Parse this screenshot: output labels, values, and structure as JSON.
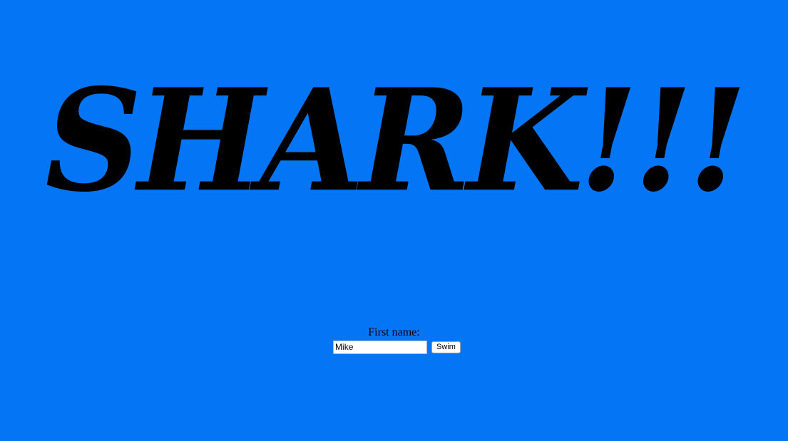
{
  "header": {
    "title": "SHARK!!!"
  },
  "form": {
    "first_name_label": "First name:",
    "first_name_value": "Mike",
    "submit_label": "Swim"
  },
  "colors": {
    "background": "#0475f5",
    "title_text": "#000000"
  }
}
